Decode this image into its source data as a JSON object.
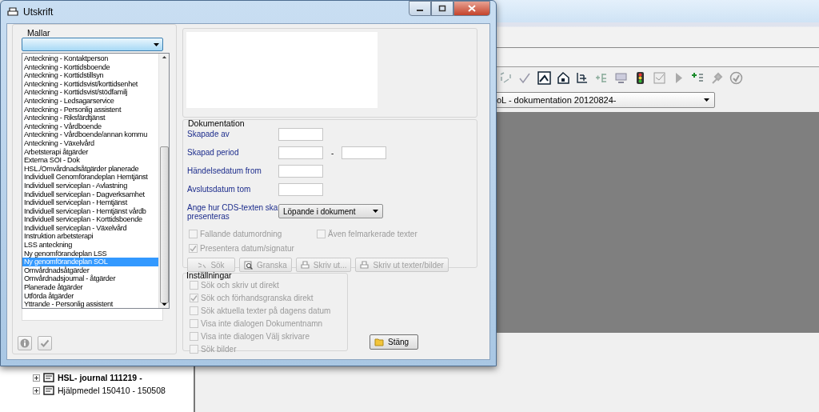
{
  "background_app": {
    "document_selector": {
      "value": "oL - dokumentation 20120824-"
    },
    "tree": [
      {
        "label": "HSL- journal 111219 -",
        "bold": true
      },
      {
        "label": "Hjälpmedel 150410 - 150508",
        "bold": false
      }
    ]
  },
  "dialog": {
    "title": "Utskrift",
    "templates": {
      "label": "Mallar",
      "items": [
        {
          "label": "Anteckning - Kontaktperson",
          "selected": false
        },
        {
          "label": "Anteckning - Korttidsboende",
          "selected": false
        },
        {
          "label": "Anteckning - Korttidstillsyn",
          "selected": false
        },
        {
          "label": "Anteckning - Korttidsvist/korttidsenhet",
          "selected": false
        },
        {
          "label": "Anteckning - Korttidsvist/stödfamilj",
          "selected": false
        },
        {
          "label": "Anteckning - Ledsagarservice",
          "selected": false
        },
        {
          "label": "Anteckning - Personlig assistent",
          "selected": false
        },
        {
          "label": "Anteckning - Riksfärdtjänst",
          "selected": false
        },
        {
          "label": "Anteckning - Vårdboende",
          "selected": false
        },
        {
          "label": "Anteckning - Vårdboende/annan kommu",
          "selected": false
        },
        {
          "label": "Anteckning - Växelvård",
          "selected": false
        },
        {
          "label": "Arbetsterapi åtgärder",
          "selected": false
        },
        {
          "label": "Externa SOI - Dok",
          "selected": false
        },
        {
          "label": "HSL./Omvårdnadsåtgärder planerade",
          "selected": false
        },
        {
          "label": "Individuell Genomförandeplan Hemtjänst",
          "selected": false
        },
        {
          "label": "Individuell serviceplan - Avlastning",
          "selected": false
        },
        {
          "label": "Individuell serviceplan - Dagverksamhet",
          "selected": false
        },
        {
          "label": "Individuell serviceplan - Hemtjänst",
          "selected": false
        },
        {
          "label": "Individuell serviceplan - Hemtjänst vårdb",
          "selected": false
        },
        {
          "label": "Individuell serviceplan - Korttidsboende",
          "selected": false
        },
        {
          "label": "Individuell serviceplan - Växelvård",
          "selected": false
        },
        {
          "label": "Instruktion arbetsterapi",
          "selected": false
        },
        {
          "label": "LSS anteckning",
          "selected": false
        },
        {
          "label": "Ny genomförandeplan LSS",
          "selected": false
        },
        {
          "label": "Ny genomförandeplan SOL",
          "selected": true
        },
        {
          "label": "Omvårdnadsåtgärder",
          "selected": false
        },
        {
          "label": "Omvårdnadsjournal - åtgärder",
          "selected": false
        },
        {
          "label": "Planerade åtgärder",
          "selected": false
        },
        {
          "label": "Utförda åtgärder",
          "selected": false
        },
        {
          "label": "Yttrande - Personlig assistent",
          "selected": false
        }
      ]
    },
    "documentation": {
      "label": "Dokumentation",
      "fields": [
        {
          "label": "Skapade av",
          "kind": "single"
        },
        {
          "label": "Skapad period",
          "kind": "range",
          "separator": "-"
        },
        {
          "label": "Händelsedatum from",
          "kind": "single"
        },
        {
          "label": "Avslutsdatum tom",
          "kind": "single"
        }
      ],
      "presentation": {
        "label": "Ange hur CDS-texten ska presenteras",
        "value": "Löpande i dokument"
      },
      "options": [
        {
          "label": "Fallande datumordning",
          "checked": false,
          "disabled": true
        },
        {
          "label": "Även felmarkerade texter",
          "checked": false,
          "disabled": true
        },
        {
          "label": "Presentera datum/signatur",
          "checked": true,
          "disabled": true
        }
      ],
      "buttons": [
        {
          "label": "Sök",
          "disabled": true
        },
        {
          "label": "Granska",
          "disabled": true
        },
        {
          "label": "Skriv ut...",
          "disabled": true
        },
        {
          "label": "Skriv ut texter/bilder",
          "disabled": true
        }
      ]
    },
    "settings": {
      "label": "Inställningar",
      "options": [
        {
          "label": "Sök och skriv ut direkt",
          "checked": false,
          "disabled": true
        },
        {
          "label": "Sök och förhandsgranska direkt",
          "checked": true,
          "disabled": true
        },
        {
          "label": "Sök aktuella texter på dagens datum",
          "checked": false,
          "disabled": true
        },
        {
          "label": "Visa inte dialogen Dokumentnamn",
          "checked": false,
          "disabled": true
        },
        {
          "label": "Visa inte dialogen Välj skrivare",
          "checked": false,
          "disabled": true
        },
        {
          "label": "Sök bilder",
          "checked": false,
          "disabled": true
        }
      ]
    },
    "close_button": {
      "label": "Stäng",
      "disabled": false
    }
  }
}
